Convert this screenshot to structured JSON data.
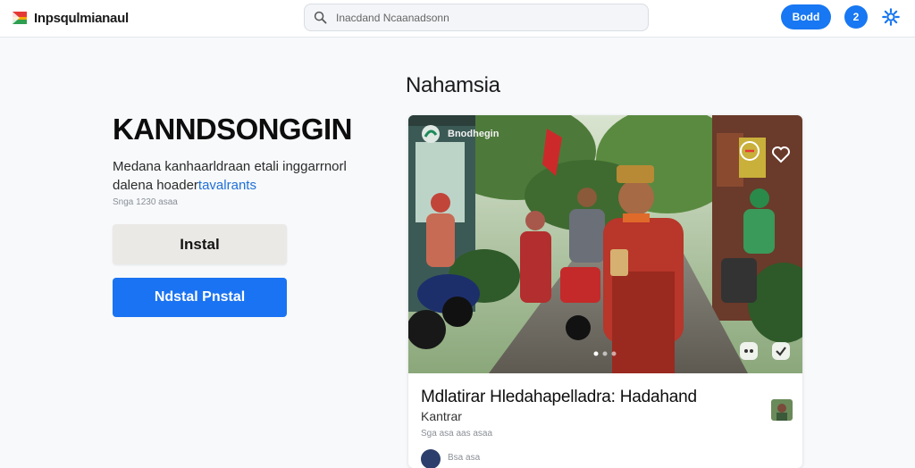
{
  "header": {
    "app_name": "Inpsqulmianaul",
    "search_placeholder": "Inacdand Ncaanadsonn",
    "button_label": "Bodd",
    "avatar_letter": "2",
    "logo_icon": "flag-logo-icon",
    "settings_icon": "gear-icon",
    "accent_color": "#1877f2"
  },
  "hero": {
    "title": "KANNDSONGGIN",
    "description_line1": "Medana kanhaarldraan etali inggarrnorl",
    "description_line2": "dalena hoader",
    "description_highlight": "tavalrants",
    "meta": "Snga 1230 asaa",
    "install_label": "Instal",
    "install_primary_label": "Ndstal Pnstal",
    "primary_color": "#1a73f2"
  },
  "feature": {
    "section_label": "Nahamsia",
    "photo_tag": "Bnodhegin",
    "photo_tag_icon": "circle-logo-icon",
    "photo_controls": [
      "alert-badge-icon",
      "heart-icon",
      "expand-icon",
      "check-icon"
    ],
    "title": "Mdlatirar Hledahapelladra: Hadahand",
    "subtitle": "Kantrar",
    "meta": "Sga asa aas asaa",
    "author": "Bsa asa"
  }
}
